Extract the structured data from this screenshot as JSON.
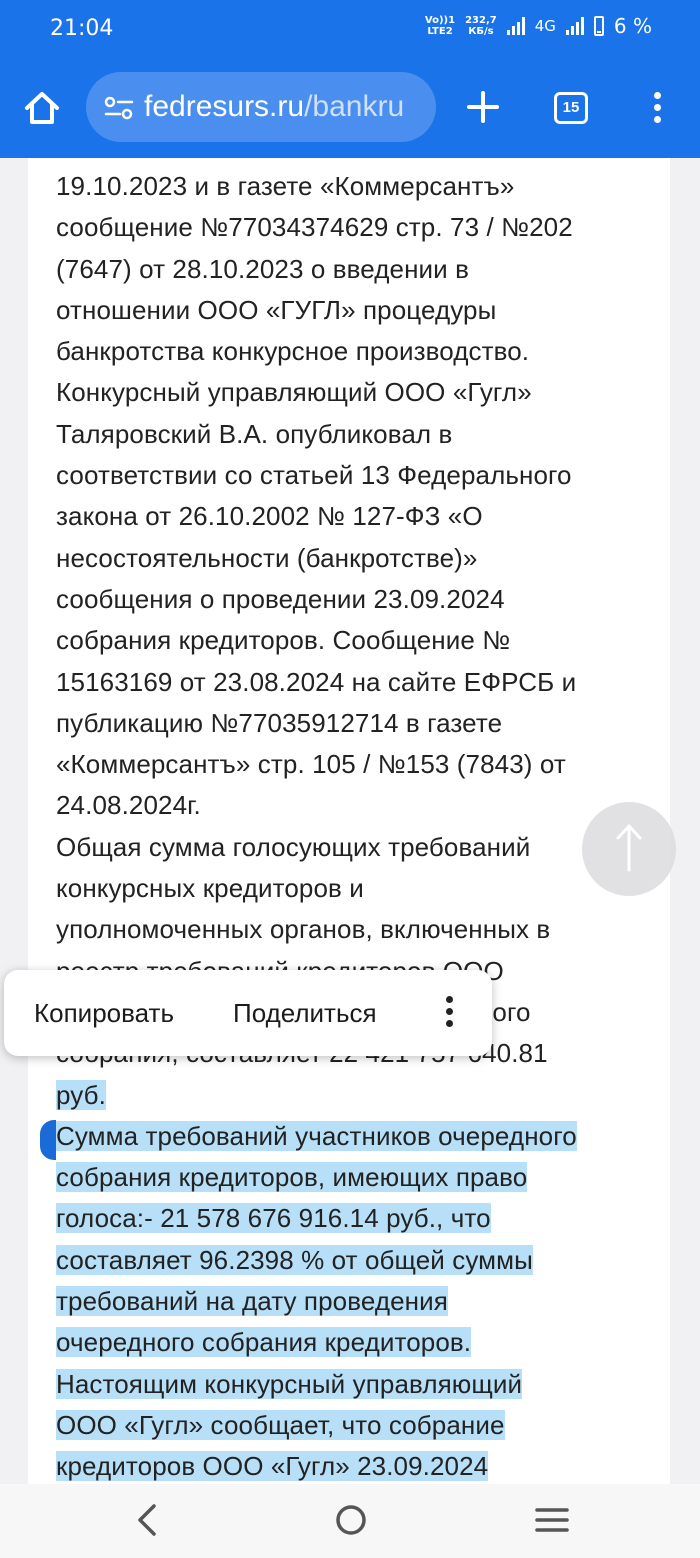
{
  "status": {
    "time": "21:04",
    "volte_top": "Vo))1",
    "volte_bottom": "LTE2",
    "speed_value": "232,7",
    "speed_unit": "КБ/s",
    "network": "4G",
    "battery": "6 %"
  },
  "browser": {
    "url_domain": "fedresurs.ru",
    "url_path": "/bankru",
    "tab_count": "15"
  },
  "content": {
    "lines": [
      "19.10.2023 и в газете «Коммерсантъ»",
      "сообщение №77034374629 стр. 73 / №202",
      "(7647) от 28.10.2023 о введении в",
      "отношении ООО «ГУГЛ» процедуры",
      "банкротства конкурсное производство.",
      "Конкурсный управляющий ООО «Гугл»",
      "Таляровский В.А. опубликовал в",
      "соответствии со статьей 13 Федерального",
      "закона от 26.10.2002 № 127-ФЗ «О",
      "несостоятельности (банкротстве)»",
      "сообщения о проведении 23.09.2024",
      "собрания кредиторов. Сообщение №",
      "15163169 от 23.08.2024 на сайте ЕФРСБ и",
      "публикацию №77035912714 в газете",
      "«Коммерсантъ» стр. 105 / №153 (7843) от",
      "24.08.2024г.",
      "Общая сумма голосующих требований",
      "конкурсных кредиторов и",
      "уполномоченных органов, включенных в",
      "реестр требований кредиторов ООО",
      "«Гугл» на дату проведения очередного",
      "собрания, составляет 22 421 757 640.81"
    ],
    "highlighted_lines": [
      "руб.",
      "Сумма требований участников очередного",
      "собрания кредиторов, имеющих право",
      "голоса:- 21 578 676 916.14 руб., что",
      "составляет 96.2398 % от общей суммы",
      "требований на дату проведения",
      "очередного собрания кредиторов.",
      "Настоящим конкурсный управляющий",
      "ООО «Гугл» сообщает, что собрание",
      "кредиторов ООО «Гугл» 23.09.2024"
    ]
  },
  "selection_menu": {
    "copy_label": "Копировать",
    "share_label": "Поделиться"
  },
  "colors": {
    "accent": "#1a73e8",
    "selection": "#b7dff7"
  }
}
